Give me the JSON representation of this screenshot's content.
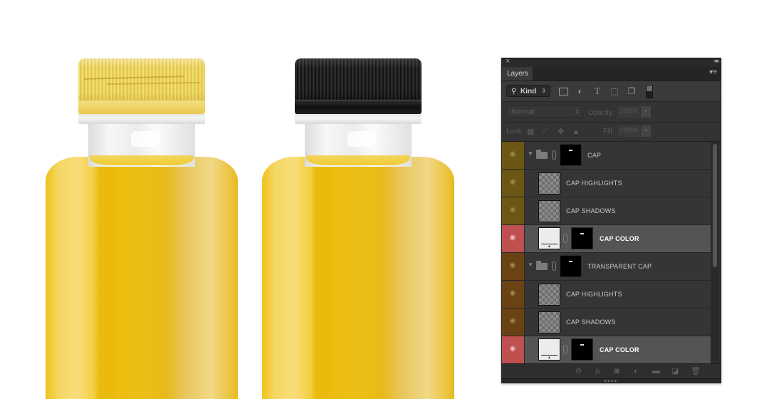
{
  "canvas": {
    "bottles": [
      {
        "cap": "yellow transparent cap",
        "liquid": "yellow juice"
      },
      {
        "cap": "black cap",
        "liquid": "yellow juice"
      }
    ]
  },
  "panel": {
    "tab_label": "Layers",
    "close_icon": "×",
    "collapse_icon": "◂◂",
    "menu_icon": "▾≡",
    "filter": {
      "kind_label": "Kind",
      "search_icon": "⚲",
      "arrows_icon": "⇕",
      "icons": [
        "image-filter",
        "adjustment-filter",
        "type-filter",
        "shape-filter",
        "smart-object-filter"
      ]
    },
    "blend": {
      "mode": "Normal",
      "opacity_label": "Opacity:",
      "opacity_value": "100%",
      "fill_label": "Fill:",
      "fill_value": "100%"
    },
    "lock_label": "Lock:",
    "layers": [
      {
        "name": "CAP",
        "type": "group",
        "eye_color": "#6b5614",
        "indent": 0,
        "selected": false
      },
      {
        "name": "CAP HIGHLIGHTS",
        "type": "pixel",
        "eye_color": "#6b5614",
        "indent": 1,
        "selected": false
      },
      {
        "name": "CAP SHADOWS",
        "type": "pixel",
        "eye_color": "#6b5614",
        "indent": 1,
        "selected": false
      },
      {
        "name": "CAP COLOR",
        "type": "fill",
        "eye_color": "#c05050",
        "indent": 1,
        "selected": true
      },
      {
        "name": "TRANSPARENT CAP",
        "type": "group",
        "eye_color": "#6b4214",
        "indent": 0,
        "selected": false
      },
      {
        "name": "CAP HIGHLIGHTS",
        "type": "pixel",
        "eye_color": "#6b4214",
        "indent": 1,
        "selected": false
      },
      {
        "name": "CAP SHADOWS",
        "type": "pixel",
        "eye_color": "#6b4214",
        "indent": 1,
        "selected": false
      },
      {
        "name": "CAP COLOR",
        "type": "fill",
        "eye_color": "#c05050",
        "indent": 1,
        "selected": true
      }
    ],
    "bottom_icons": [
      "link-layers",
      "fx",
      "add-mask",
      "new-adjustment",
      "new-group",
      "new-layer",
      "delete-layer"
    ]
  }
}
